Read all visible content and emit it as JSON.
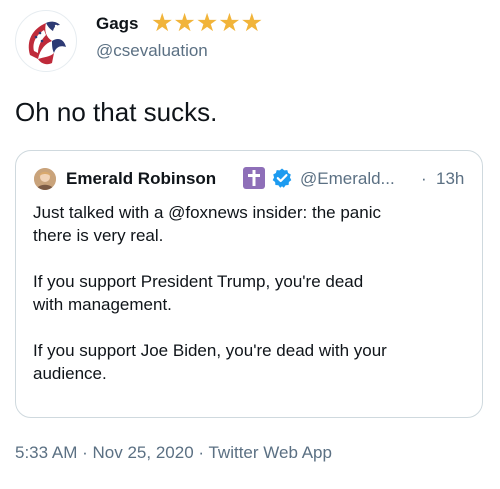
{
  "user": {
    "display_name": "Gags",
    "stars": "★★★★★",
    "handle": "@csevaluation"
  },
  "tweet": {
    "text": "Oh no that sucks."
  },
  "quoted": {
    "name": "Emerald Robinson",
    "handle": "@Emerald...",
    "dot": "·",
    "time": "13h",
    "paragraphs": [
      "Just talked with a @foxnews insider: the panic\nthere is very real.",
      "If you support President Trump, you're dead\nwith management.",
      "If you support Joe Biden, you're dead with your\naudience."
    ]
  },
  "meta": {
    "time": "5:33 AM",
    "sep1": "·",
    "date": "Nov 25, 2020",
    "sep2": "·",
    "source": "Twitter Web App"
  },
  "colors": {
    "star": "#f1b43a",
    "secondary_text": "#5b7083",
    "verified": "#1d9bf0",
    "cross_badge": "#8e6fb8"
  },
  "icons": {
    "avatar": "eagle-flag-avatar",
    "cross": "cross-icon",
    "verified": "verified-badge-icon"
  }
}
